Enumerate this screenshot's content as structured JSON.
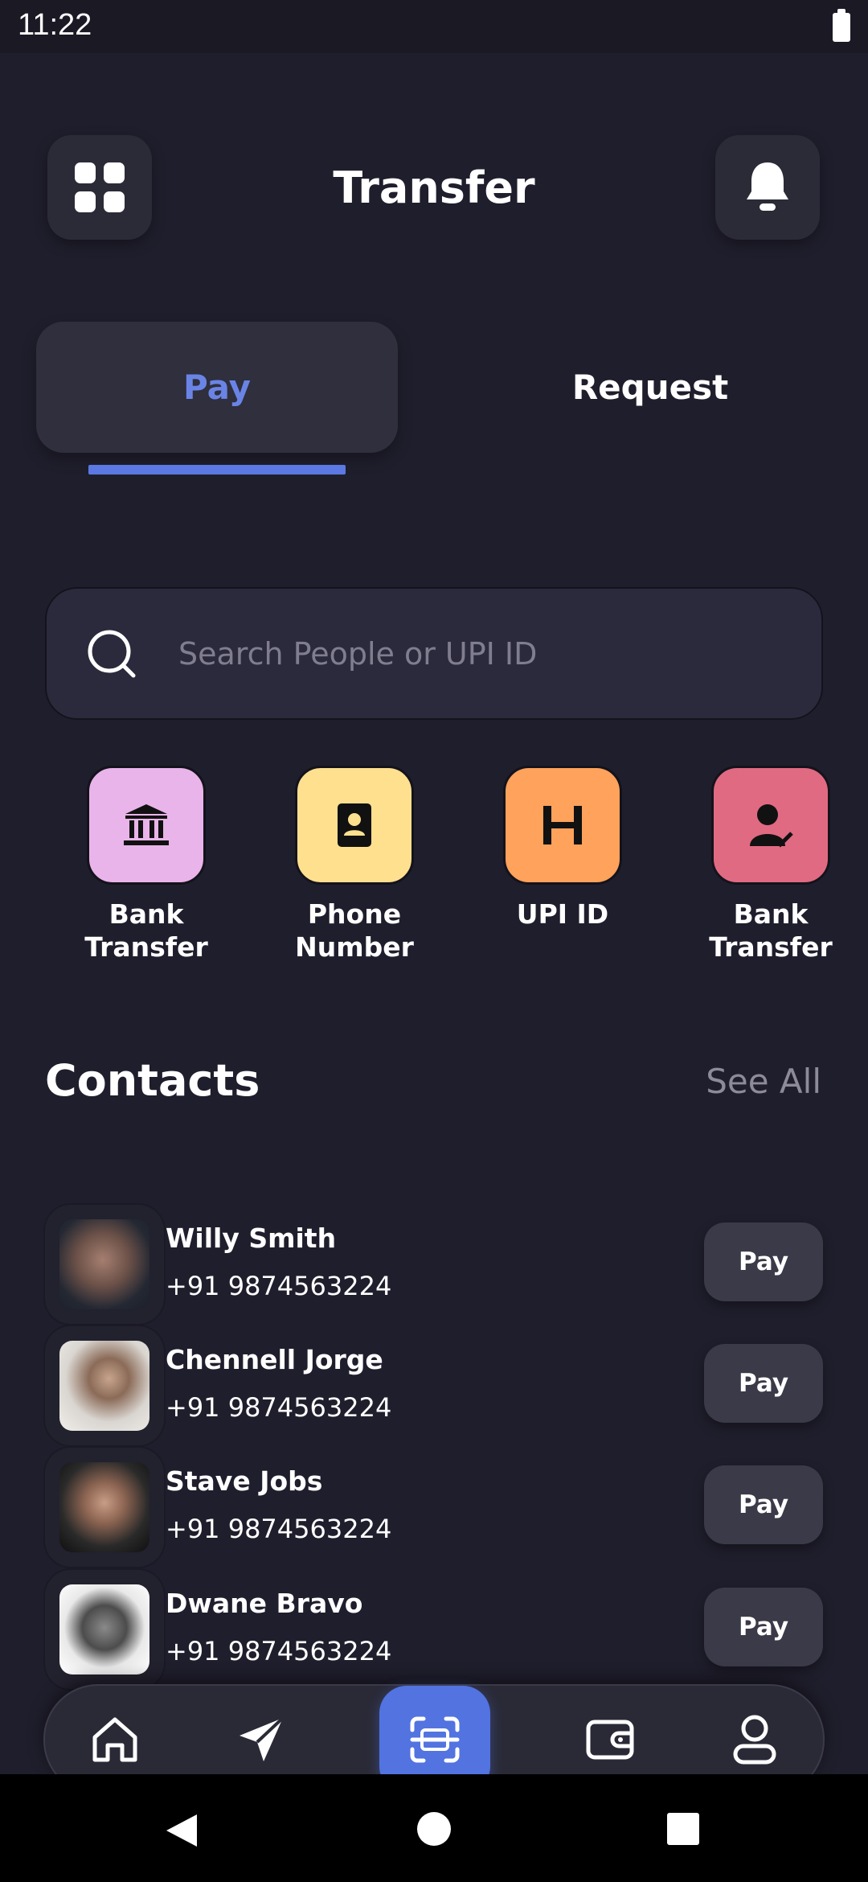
{
  "status_bar": {
    "time": "11:22"
  },
  "header": {
    "title": "Transfer",
    "menu_icon": "grid-icon",
    "notification_icon": "bell-icon"
  },
  "tabs": [
    {
      "label": "Pay",
      "active": true
    },
    {
      "label": "Request",
      "active": false
    }
  ],
  "search": {
    "placeholder": "Search People or UPI ID",
    "value": ""
  },
  "quick_actions": [
    {
      "label": "Bank Transfer",
      "line1": "Bank",
      "line2": "Transfer",
      "icon": "bank-icon",
      "color": "#e9b4e9"
    },
    {
      "label": "Phone Number",
      "line1": "Phone",
      "line2": "Number",
      "icon": "contact-book-icon",
      "color": "#ffe08f"
    },
    {
      "label": "UPI ID",
      "line1": "UPI ID",
      "line2": "",
      "icon": "upi-icon",
      "color": "#ffa25b"
    },
    {
      "label": "Bank Transfer",
      "line1": "Bank",
      "line2": "Transfer",
      "icon": "user-check-icon",
      "color": "#e06a82"
    }
  ],
  "contacts_section": {
    "title": "Contacts",
    "see_all": "See All"
  },
  "contacts": [
    {
      "name": "Willy Smith",
      "phone": "+91 9874563224",
      "action": "Pay"
    },
    {
      "name": "Chennell Jorge",
      "phone": "+91 9874563224",
      "action": "Pay"
    },
    {
      "name": "Stave Jobs",
      "phone": "+91 9874563224",
      "action": "Pay"
    },
    {
      "name": "Dwane Bravo",
      "phone": "+91 9874563224",
      "action": "Pay"
    }
  ],
  "bottom_nav": [
    {
      "icon": "home-icon"
    },
    {
      "icon": "send-icon"
    },
    {
      "icon": "scan-icon",
      "active": true
    },
    {
      "icon": "wallet-icon"
    },
    {
      "icon": "profile-icon"
    }
  ],
  "colors": {
    "background": "#1f1e2c",
    "accent": "#5b78e3",
    "card": "#2b2b38"
  }
}
